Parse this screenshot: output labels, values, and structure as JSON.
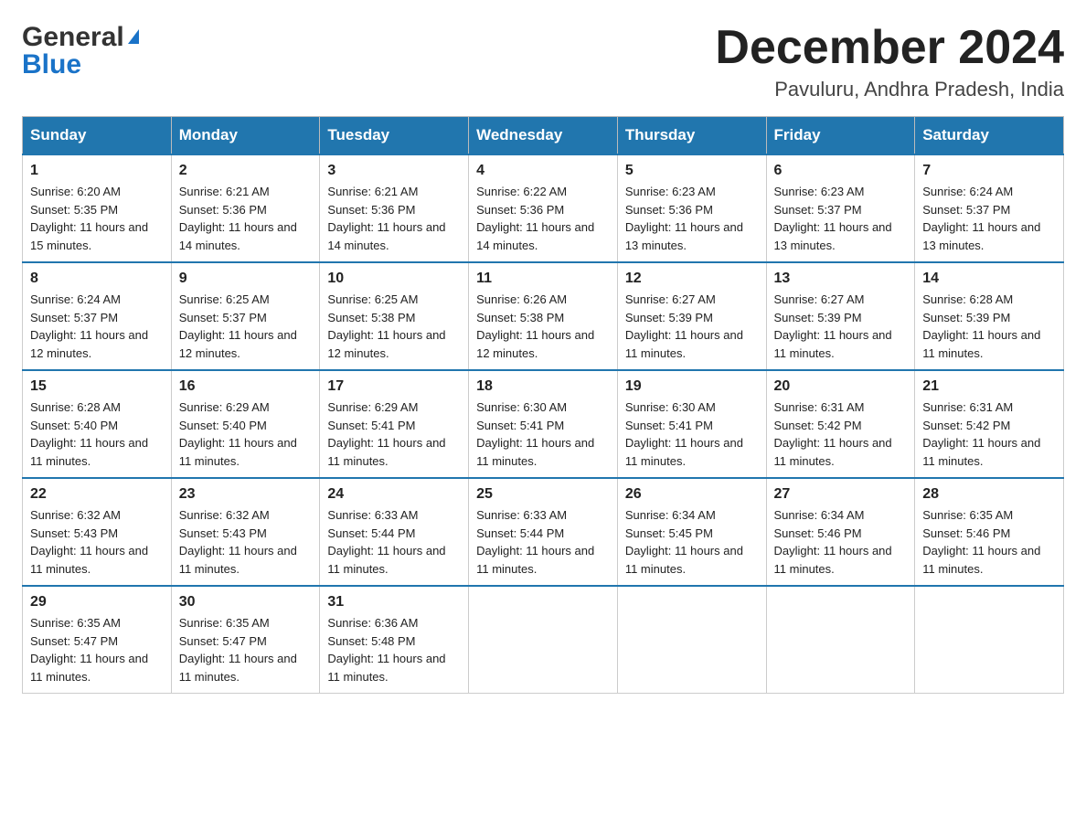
{
  "logo": {
    "text_general": "General",
    "text_blue": "Blue",
    "arrow": "▶"
  },
  "title": "December 2024",
  "subtitle": "Pavuluru, Andhra Pradesh, India",
  "days_of_week": [
    "Sunday",
    "Monday",
    "Tuesday",
    "Wednesday",
    "Thursday",
    "Friday",
    "Saturday"
  ],
  "weeks": [
    [
      {
        "day": "1",
        "sunrise": "Sunrise: 6:20 AM",
        "sunset": "Sunset: 5:35 PM",
        "daylight": "Daylight: 11 hours and 15 minutes."
      },
      {
        "day": "2",
        "sunrise": "Sunrise: 6:21 AM",
        "sunset": "Sunset: 5:36 PM",
        "daylight": "Daylight: 11 hours and 14 minutes."
      },
      {
        "day": "3",
        "sunrise": "Sunrise: 6:21 AM",
        "sunset": "Sunset: 5:36 PM",
        "daylight": "Daylight: 11 hours and 14 minutes."
      },
      {
        "day": "4",
        "sunrise": "Sunrise: 6:22 AM",
        "sunset": "Sunset: 5:36 PM",
        "daylight": "Daylight: 11 hours and 14 minutes."
      },
      {
        "day": "5",
        "sunrise": "Sunrise: 6:23 AM",
        "sunset": "Sunset: 5:36 PM",
        "daylight": "Daylight: 11 hours and 13 minutes."
      },
      {
        "day": "6",
        "sunrise": "Sunrise: 6:23 AM",
        "sunset": "Sunset: 5:37 PM",
        "daylight": "Daylight: 11 hours and 13 minutes."
      },
      {
        "day": "7",
        "sunrise": "Sunrise: 6:24 AM",
        "sunset": "Sunset: 5:37 PM",
        "daylight": "Daylight: 11 hours and 13 minutes."
      }
    ],
    [
      {
        "day": "8",
        "sunrise": "Sunrise: 6:24 AM",
        "sunset": "Sunset: 5:37 PM",
        "daylight": "Daylight: 11 hours and 12 minutes."
      },
      {
        "day": "9",
        "sunrise": "Sunrise: 6:25 AM",
        "sunset": "Sunset: 5:37 PM",
        "daylight": "Daylight: 11 hours and 12 minutes."
      },
      {
        "day": "10",
        "sunrise": "Sunrise: 6:25 AM",
        "sunset": "Sunset: 5:38 PM",
        "daylight": "Daylight: 11 hours and 12 minutes."
      },
      {
        "day": "11",
        "sunrise": "Sunrise: 6:26 AM",
        "sunset": "Sunset: 5:38 PM",
        "daylight": "Daylight: 11 hours and 12 minutes."
      },
      {
        "day": "12",
        "sunrise": "Sunrise: 6:27 AM",
        "sunset": "Sunset: 5:39 PM",
        "daylight": "Daylight: 11 hours and 11 minutes."
      },
      {
        "day": "13",
        "sunrise": "Sunrise: 6:27 AM",
        "sunset": "Sunset: 5:39 PM",
        "daylight": "Daylight: 11 hours and 11 minutes."
      },
      {
        "day": "14",
        "sunrise": "Sunrise: 6:28 AM",
        "sunset": "Sunset: 5:39 PM",
        "daylight": "Daylight: 11 hours and 11 minutes."
      }
    ],
    [
      {
        "day": "15",
        "sunrise": "Sunrise: 6:28 AM",
        "sunset": "Sunset: 5:40 PM",
        "daylight": "Daylight: 11 hours and 11 minutes."
      },
      {
        "day": "16",
        "sunrise": "Sunrise: 6:29 AM",
        "sunset": "Sunset: 5:40 PM",
        "daylight": "Daylight: 11 hours and 11 minutes."
      },
      {
        "day": "17",
        "sunrise": "Sunrise: 6:29 AM",
        "sunset": "Sunset: 5:41 PM",
        "daylight": "Daylight: 11 hours and 11 minutes."
      },
      {
        "day": "18",
        "sunrise": "Sunrise: 6:30 AM",
        "sunset": "Sunset: 5:41 PM",
        "daylight": "Daylight: 11 hours and 11 minutes."
      },
      {
        "day": "19",
        "sunrise": "Sunrise: 6:30 AM",
        "sunset": "Sunset: 5:41 PM",
        "daylight": "Daylight: 11 hours and 11 minutes."
      },
      {
        "day": "20",
        "sunrise": "Sunrise: 6:31 AM",
        "sunset": "Sunset: 5:42 PM",
        "daylight": "Daylight: 11 hours and 11 minutes."
      },
      {
        "day": "21",
        "sunrise": "Sunrise: 6:31 AM",
        "sunset": "Sunset: 5:42 PM",
        "daylight": "Daylight: 11 hours and 11 minutes."
      }
    ],
    [
      {
        "day": "22",
        "sunrise": "Sunrise: 6:32 AM",
        "sunset": "Sunset: 5:43 PM",
        "daylight": "Daylight: 11 hours and 11 minutes."
      },
      {
        "day": "23",
        "sunrise": "Sunrise: 6:32 AM",
        "sunset": "Sunset: 5:43 PM",
        "daylight": "Daylight: 11 hours and 11 minutes."
      },
      {
        "day": "24",
        "sunrise": "Sunrise: 6:33 AM",
        "sunset": "Sunset: 5:44 PM",
        "daylight": "Daylight: 11 hours and 11 minutes."
      },
      {
        "day": "25",
        "sunrise": "Sunrise: 6:33 AM",
        "sunset": "Sunset: 5:44 PM",
        "daylight": "Daylight: 11 hours and 11 minutes."
      },
      {
        "day": "26",
        "sunrise": "Sunrise: 6:34 AM",
        "sunset": "Sunset: 5:45 PM",
        "daylight": "Daylight: 11 hours and 11 minutes."
      },
      {
        "day": "27",
        "sunrise": "Sunrise: 6:34 AM",
        "sunset": "Sunset: 5:46 PM",
        "daylight": "Daylight: 11 hours and 11 minutes."
      },
      {
        "day": "28",
        "sunrise": "Sunrise: 6:35 AM",
        "sunset": "Sunset: 5:46 PM",
        "daylight": "Daylight: 11 hours and 11 minutes."
      }
    ],
    [
      {
        "day": "29",
        "sunrise": "Sunrise: 6:35 AM",
        "sunset": "Sunset: 5:47 PM",
        "daylight": "Daylight: 11 hours and 11 minutes."
      },
      {
        "day": "30",
        "sunrise": "Sunrise: 6:35 AM",
        "sunset": "Sunset: 5:47 PM",
        "daylight": "Daylight: 11 hours and 11 minutes."
      },
      {
        "day": "31",
        "sunrise": "Sunrise: 6:36 AM",
        "sunset": "Sunset: 5:48 PM",
        "daylight": "Daylight: 11 hours and 11 minutes."
      },
      null,
      null,
      null,
      null
    ]
  ]
}
